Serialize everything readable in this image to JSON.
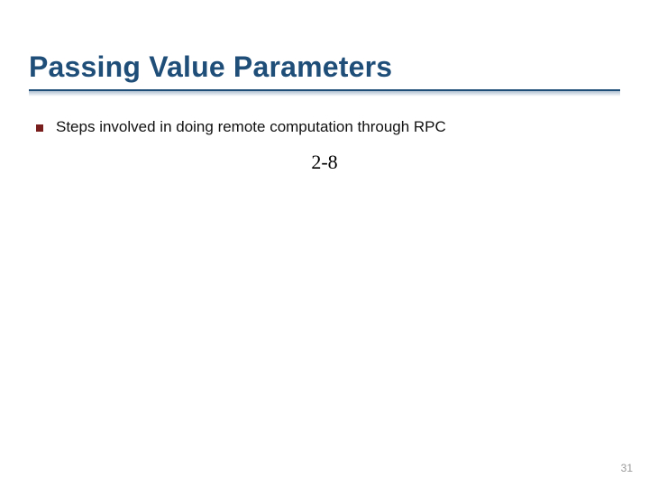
{
  "slide": {
    "title": "Passing Value Parameters",
    "bullets": [
      {
        "text": "Steps involved in doing remote computation through RPC"
      }
    ],
    "figure_label": "2-8",
    "page_number": "31"
  },
  "colors": {
    "title": "#1f4e79",
    "bullet_marker": "#7a1d1d",
    "page_number": "#9a9a9a"
  }
}
